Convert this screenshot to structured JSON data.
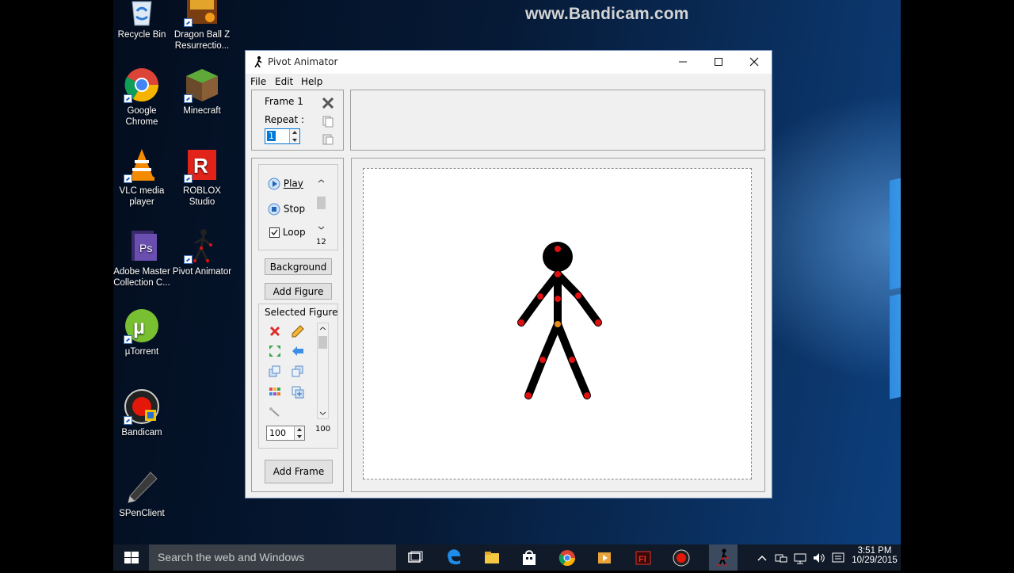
{
  "watermark": "www.Bandicam.com",
  "desktop_icons": [
    {
      "label": "Recycle Bin",
      "icon": "recycle-bin-icon"
    },
    {
      "label": "Dragon Ball Z Resurrectio...",
      "icon": "dragon-ball-icon"
    },
    {
      "label": "Google Chrome",
      "icon": "chrome-icon"
    },
    {
      "label": "Minecraft",
      "icon": "minecraft-icon"
    },
    {
      "label": "VLC media player",
      "icon": "vlc-icon"
    },
    {
      "label": "ROBLOX Studio",
      "icon": "roblox-icon"
    },
    {
      "label": "Adobe Master Collection C...",
      "icon": "adobe-icon"
    },
    {
      "label": "Pivot Animator",
      "icon": "pivot-icon"
    },
    {
      "label": "µTorrent",
      "icon": "utorrent-icon"
    },
    {
      "label": "Bandicam",
      "icon": "bandicam-icon"
    },
    {
      "label": "SPenClient",
      "icon": "pen-icon"
    }
  ],
  "window": {
    "title": "Pivot Animator",
    "menu": [
      "File",
      "Edit",
      "Help"
    ],
    "frame": {
      "label": "Frame 1",
      "repeat_label": "Repeat :",
      "repeat_value": "1"
    },
    "playback": {
      "play": "Play",
      "stop": "Stop",
      "loop": "Loop",
      "loop_checked": true,
      "speed": "12"
    },
    "buttons": {
      "background": "Background",
      "add_figure": "Add Figure",
      "add_frame": "Add Frame"
    },
    "selected_figure": {
      "heading": "Selected Figure",
      "scale_value": "100",
      "scale_readout": "100"
    }
  },
  "taskbar": {
    "search_placeholder": "Search the web and Windows",
    "time": "3:51 PM",
    "date": "10/29/2015"
  },
  "colors": {
    "joint": "#e01010",
    "origin": "#e88a1a",
    "accent": "#0078d7"
  }
}
